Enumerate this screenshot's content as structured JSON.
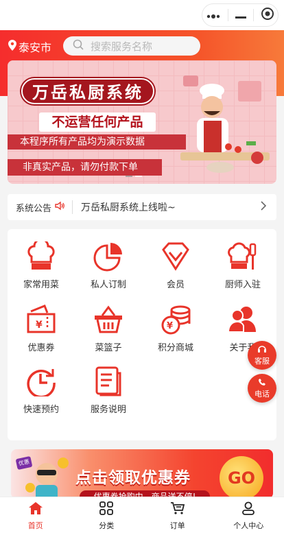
{
  "header": {
    "city": "泰安市",
    "search_placeholder": "搜索服务名称"
  },
  "banner": {
    "title": "万岳私厨系统",
    "subtitle": "不运营任何产品",
    "line1": "本程序所有产品均为演示数据",
    "line2": "非真实产品，请勿付款下单"
  },
  "notice": {
    "label": "系统公告",
    "text": "万岳私厨系统上线啦~"
  },
  "grid": [
    {
      "label": "家常用菜",
      "icon": "chef-hat-icon"
    },
    {
      "label": "私人订制",
      "icon": "pie-chart-icon"
    },
    {
      "label": "会员",
      "icon": "diamond-icon"
    },
    {
      "label": "厨师入驻",
      "icon": "chef-tools-icon"
    },
    {
      "label": "优惠券",
      "icon": "coupon-icon"
    },
    {
      "label": "菜篮子",
      "icon": "basket-icon"
    },
    {
      "label": "积分商城",
      "icon": "coins-icon"
    },
    {
      "label": "关于我",
      "icon": "users-icon"
    },
    {
      "label": "快速预约",
      "icon": "clock-icon"
    },
    {
      "label": "服务说明",
      "icon": "document-icon"
    }
  ],
  "float": {
    "service": "客服",
    "phone": "电话"
  },
  "promo": {
    "tag": "优惠",
    "title": "点击领取优惠券",
    "sub": "优惠券抢购中，商品送不停!",
    "go": "GO"
  },
  "tabs": [
    {
      "label": "首页",
      "icon": "home-icon"
    },
    {
      "label": "分类",
      "icon": "grid-icon"
    },
    {
      "label": "订单",
      "icon": "cart-icon"
    },
    {
      "label": "个人中心",
      "icon": "user-icon"
    }
  ],
  "colors": {
    "accent": "#e8342a",
    "header_start": "#f52d2d",
    "header_end": "#f77a3a"
  }
}
